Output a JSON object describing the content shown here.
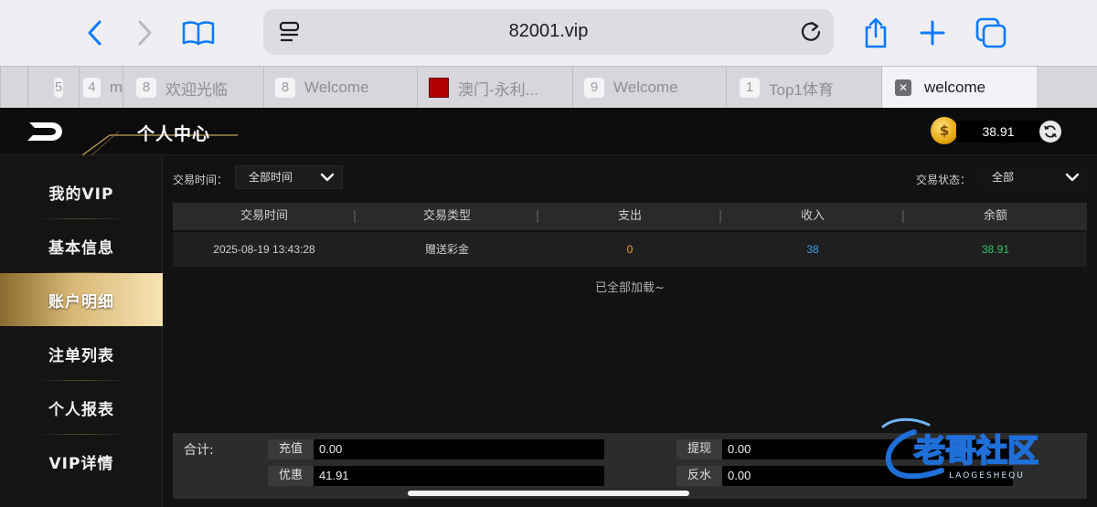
{
  "browser": {
    "url": "82001.vip",
    "tabs": [
      {
        "num": "5",
        "title": ""
      },
      {
        "num": "4",
        "title": "m"
      },
      {
        "num": "8",
        "title": "欢迎光临"
      },
      {
        "num": "8",
        "title": "Welcome"
      },
      {
        "num": "",
        "title": "澳门-永利..."
      },
      {
        "num": "9",
        "title": "Welcome"
      },
      {
        "num": "1",
        "title": "Top1体育"
      },
      {
        "num": "",
        "title": "welcome"
      }
    ],
    "icons": [
      "back-icon",
      "forward-icon",
      "bookmarks-icon",
      "reader-icon",
      "reload-icon",
      "share-icon",
      "new-tab-icon",
      "tabs-overview-icon"
    ]
  },
  "header": {
    "title": "个人中心",
    "balance": "38.91"
  },
  "sidebar": {
    "items": [
      {
        "label": "我的VIP"
      },
      {
        "label": "基本信息"
      },
      {
        "label": "账户明细"
      },
      {
        "label": "注单列表"
      },
      {
        "label": "个人报表"
      },
      {
        "label": "VIP详情"
      }
    ],
    "active_index": 2
  },
  "filters": {
    "time_label": "交易时间：",
    "time_value": "全部时间",
    "status_label": "交易状态：",
    "status_value": "全部"
  },
  "table": {
    "headers": [
      "交易时间",
      "交易类型",
      "支出",
      "收入",
      "余额"
    ],
    "rows": [
      {
        "time": "2025-08-19 13:43:28",
        "type": "赠送彩金",
        "expense": "0",
        "income": "38",
        "balance": "38.91"
      }
    ],
    "loaded_text": "已全部加载~"
  },
  "summary": {
    "label": "合计:",
    "recharge_label": "充值",
    "recharge_value": "0.00",
    "withdraw_label": "提现",
    "withdraw_value": "0.00",
    "discount_label": "优惠",
    "discount_value": "41.91",
    "rebate_label": "反水",
    "rebate_value": "0.00"
  },
  "watermark": {
    "text": "老哥社区",
    "sub": "LAOGESHEQU"
  },
  "colors": {
    "accent_gold": "#d9b877",
    "expense_orange": "#f0a030",
    "income_blue": "#3aa0e8",
    "balance_green": "#2ec86a",
    "ios_blue": "#0a7aff"
  }
}
